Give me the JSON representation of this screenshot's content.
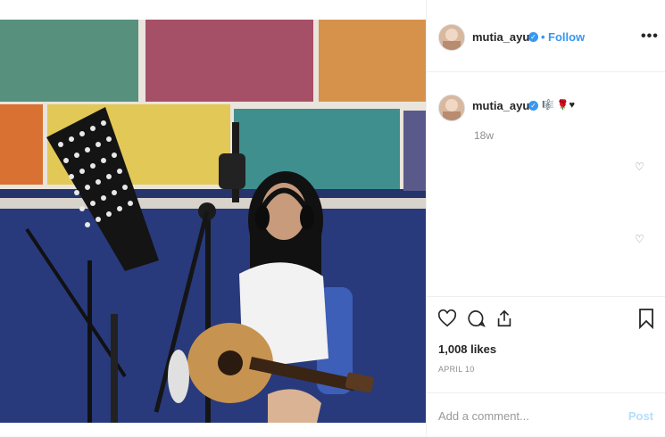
{
  "header": {
    "username": "mutia_ayuu",
    "separator": "•",
    "follow_label": "Follow",
    "more_label": "•••"
  },
  "caption": {
    "username": "mutia_ayuu",
    "emojis": "🎼 🌹♥",
    "time": "18w"
  },
  "comments": [
    {
      "heart": "♡"
    },
    {
      "heart": "♡"
    }
  ],
  "actions": {
    "like_icon": "heart-icon",
    "comment_icon": "comment-icon",
    "share_icon": "share-icon",
    "save_icon": "bookmark-icon"
  },
  "likes": "1,008 likes",
  "date": "APRIL 10",
  "comment_box": {
    "placeholder": "Add a comment...",
    "post_label": "Post"
  },
  "colors": {
    "accent": "#3897f0",
    "post_disabled": "#b2dffc",
    "muted": "#8e8e8e"
  }
}
